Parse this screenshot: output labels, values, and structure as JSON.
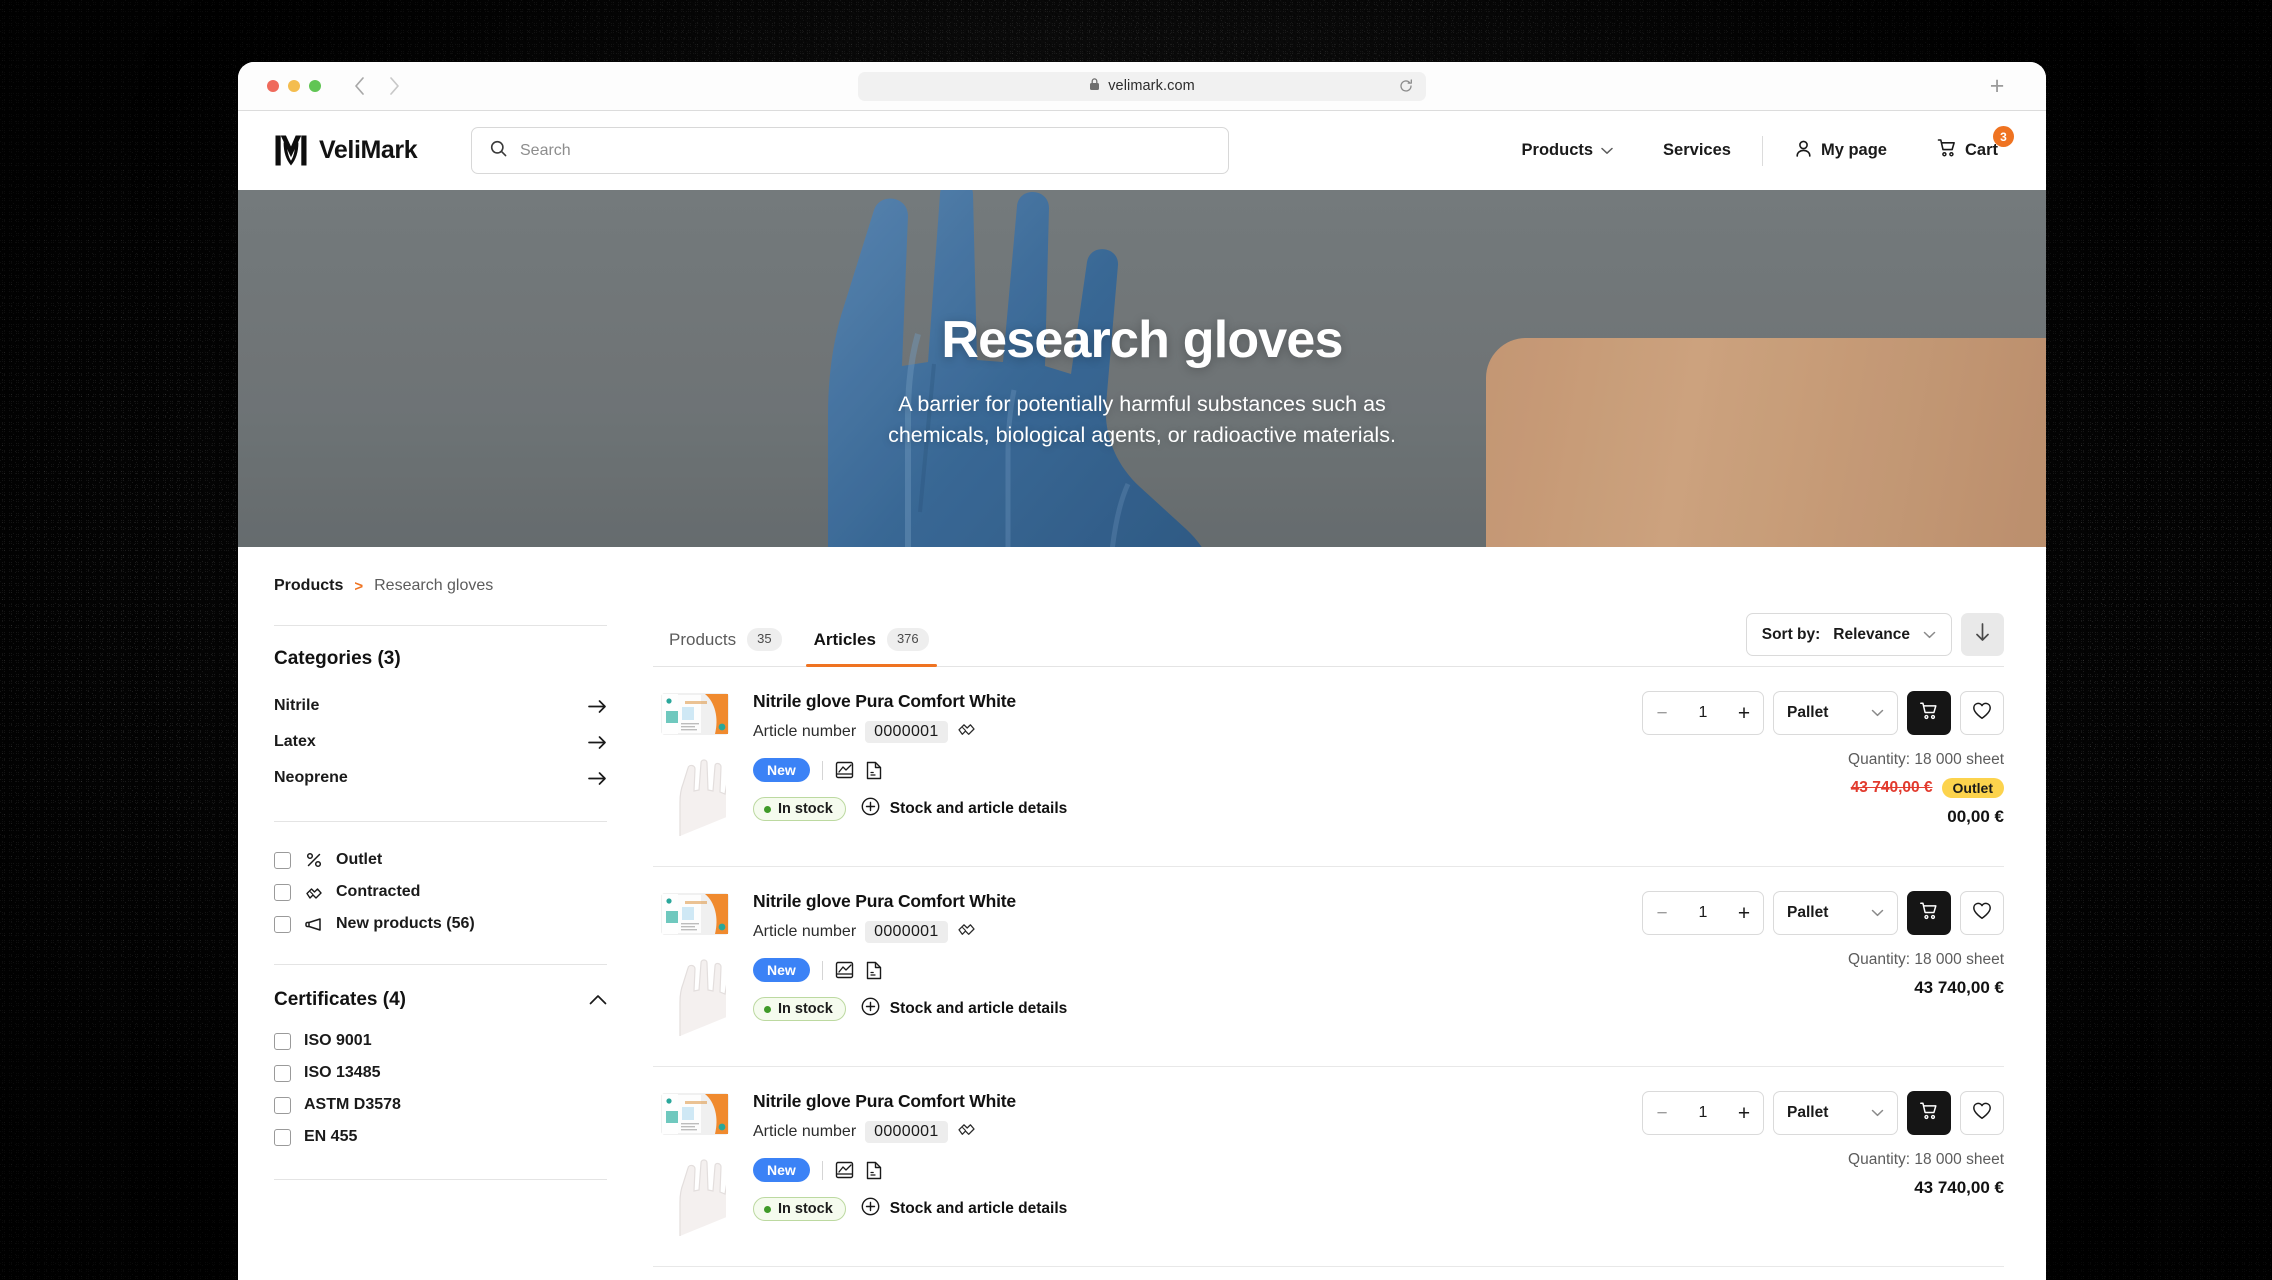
{
  "browser": {
    "url": "velimark.com",
    "lock_icon": "lock-icon",
    "reload_icon": "reload-icon",
    "back_icon": "chevron-left-icon",
    "forward_icon": "chevron-right-icon",
    "new_tab_label": "+"
  },
  "header": {
    "brand": "VeliMark",
    "search_placeholder": "Search",
    "nav": [
      {
        "label": "Products",
        "has_chevron": true
      },
      {
        "label": "Services",
        "has_chevron": false
      }
    ],
    "account_label": "My page",
    "cart_label": "Cart",
    "cart_count": "3"
  },
  "hero": {
    "title": "Research gloves",
    "subtitle": "A barrier for potentially harmful substances such as chemicals, biological agents, or radioactive materials."
  },
  "breadcrumb": {
    "root": "Products",
    "separator": ">",
    "current": "Research gloves"
  },
  "sidebar": {
    "categories_title": "Categories (3)",
    "categories": [
      {
        "label": "Nitrile"
      },
      {
        "label": "Latex"
      },
      {
        "label": "Neoprene"
      }
    ],
    "filters": [
      {
        "label": "Outlet",
        "icon": "percent-icon"
      },
      {
        "label": "Contracted",
        "icon": "handshake-icon"
      },
      {
        "label": "New products (56)",
        "icon": "megaphone-icon"
      }
    ],
    "certificates_title": "Certificates (4)",
    "certificates": [
      {
        "label": "ISO 9001"
      },
      {
        "label": "ISO 13485"
      },
      {
        "label": "ASTM D3578"
      },
      {
        "label": "EN 455"
      }
    ]
  },
  "toolbar": {
    "tabs": [
      {
        "label": "Products",
        "count": "35",
        "active": false
      },
      {
        "label": "Articles",
        "count": "376",
        "active": true
      }
    ],
    "sort_label": "Sort by:",
    "sort_value": "Relevance",
    "sort_direction_icon": "arrow-down-icon"
  },
  "products": [
    {
      "title": "Nitrile glove Pura Comfort White",
      "article_label": "Article number",
      "article_number": "0000001",
      "contract_icon": "handshake-icon",
      "badge_new": "New",
      "chart_icon": "chart-icon",
      "pdf_icon": "pdf-icon",
      "stock_status": "In stock",
      "details_label": "Stock and article details",
      "quantity_input": "1",
      "unit": "Pallet",
      "quantity_line": "Quantity: 18 000 sheet",
      "price_old": "43 740,00 €",
      "outlet_badge": "Outlet",
      "price_now": "00,00 €"
    },
    {
      "title": "Nitrile glove Pura Comfort White",
      "article_label": "Article number",
      "article_number": "0000001",
      "contract_icon": "handshake-icon",
      "badge_new": "New",
      "chart_icon": "chart-icon",
      "pdf_icon": "pdf-icon",
      "stock_status": "In stock",
      "details_label": "Stock and article details",
      "quantity_input": "1",
      "unit": "Pallet",
      "quantity_line": "Quantity: 18 000 sheet",
      "price_old": "",
      "outlet_badge": "",
      "price_now": "43 740,00 €"
    },
    {
      "title": "Nitrile glove Pura Comfort White",
      "article_label": "Article number",
      "article_number": "0000001",
      "contract_icon": "handshake-icon",
      "badge_new": "New",
      "chart_icon": "chart-icon",
      "pdf_icon": "pdf-icon",
      "stock_status": "In stock",
      "details_label": "Stock and article details",
      "quantity_input": "1",
      "unit": "Pallet",
      "quantity_line": "Quantity: 18 000 sheet",
      "price_old": "",
      "outlet_badge": "",
      "price_now": "43 740,00 €"
    }
  ],
  "colors": {
    "accent": "#ef7321",
    "badge_new": "#3b82f6",
    "outlet": "#fcd34d",
    "price_old": "#e23b2e",
    "stock_dot": "#3f9a28",
    "cart_button": "#151515"
  }
}
